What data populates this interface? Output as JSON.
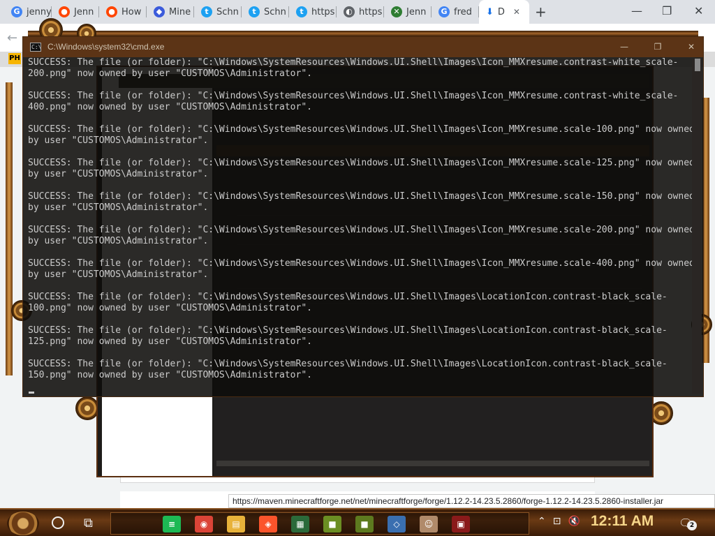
{
  "browser": {
    "tabs": [
      {
        "title": "jenny",
        "icon": "google-icon",
        "color": "#4285f4",
        "glyph": "G"
      },
      {
        "title": "Jenn",
        "icon": "reddit-icon",
        "color": "#ff4500",
        "glyph": "●"
      },
      {
        "title": "How",
        "icon": "reddit-icon",
        "color": "#ff4500",
        "glyph": "●"
      },
      {
        "title": "Mine",
        "icon": "shield-icon",
        "color": "#3b5bdb",
        "glyph": "◆"
      },
      {
        "title": "Schn",
        "icon": "twitter-icon",
        "color": "#1da1f2",
        "glyph": "t"
      },
      {
        "title": "Schn",
        "icon": "twitter-icon",
        "color": "#1da1f2",
        "glyph": "t"
      },
      {
        "title": "https",
        "icon": "twitter-icon",
        "color": "#1da1f2",
        "glyph": "t"
      },
      {
        "title": "https",
        "icon": "globe-icon",
        "color": "#5f6368",
        "glyph": "◐"
      },
      {
        "title": "Jenn",
        "icon": "sword-icon",
        "color": "#2e7d32",
        "glyph": "✕"
      },
      {
        "title": "fred",
        "icon": "google-icon",
        "color": "#4285f4",
        "glyph": "G"
      }
    ],
    "active_tab": {
      "title": "D",
      "icon": "download-icon",
      "glyph": "⬇"
    },
    "close_glyph": "✕",
    "new_tab_glyph": "+",
    "window_controls": {
      "minimize": "—",
      "maximize": "❐",
      "close": "✕"
    },
    "back_glyph": "←",
    "extensions": [
      "✦",
      "▣",
      "●",
      "⋮"
    ],
    "bookmark_badge": "PH"
  },
  "cmd": {
    "title": "C:\\Windows\\system32\\cmd.exe",
    "icon_glyph": "C:\\",
    "controls": {
      "minimize": "—",
      "maximize": "❐",
      "close": "✕"
    },
    "lines": [
      "SUCCESS: The file (or folder): \"C:\\Windows\\SystemResources\\Windows.UI.Shell\\Images\\Icon_MMXresume.contrast-white_scale-200.png\" now owned by user \"CUSTOMOS\\Administrator\".",
      "SUCCESS: The file (or folder): \"C:\\Windows\\SystemResources\\Windows.UI.Shell\\Images\\Icon_MMXresume.contrast-white_scale-400.png\" now owned by user \"CUSTOMOS\\Administrator\".",
      "SUCCESS: The file (or folder): \"C:\\Windows\\SystemResources\\Windows.UI.Shell\\Images\\Icon_MMXresume.scale-100.png\" now owned by user \"CUSTOMOS\\Administrator\".",
      "SUCCESS: The file (or folder): \"C:\\Windows\\SystemResources\\Windows.UI.Shell\\Images\\Icon_MMXresume.scale-125.png\" now owned by user \"CUSTOMOS\\Administrator\".",
      "SUCCESS: The file (or folder): \"C:\\Windows\\SystemResources\\Windows.UI.Shell\\Images\\Icon_MMXresume.scale-150.png\" now owned by user \"CUSTOMOS\\Administrator\".",
      "SUCCESS: The file (or folder): \"C:\\Windows\\SystemResources\\Windows.UI.Shell\\Images\\Icon_MMXresume.scale-200.png\" now owned by user \"CUSTOMOS\\Administrator\".",
      "SUCCESS: The file (or folder): \"C:\\Windows\\SystemResources\\Windows.UI.Shell\\Images\\Icon_MMXresume.scale-400.png\" now owned by user \"CUSTOMOS\\Administrator\".",
      "SUCCESS: The file (or folder): \"C:\\Windows\\SystemResources\\Windows.UI.Shell\\Images\\LocationIcon.contrast-black_scale-100.png\" now owned by user \"CUSTOMOS\\Administrator\".",
      "SUCCESS: The file (or folder): \"C:\\Windows\\SystemResources\\Windows.UI.Shell\\Images\\LocationIcon.contrast-black_scale-125.png\" now owned by user \"CUSTOMOS\\Administrator\".",
      "SUCCESS: The file (or folder): \"C:\\Windows\\SystemResources\\Windows.UI.Shell\\Images\\LocationIcon.contrast-black_scale-150.png\" now owned by user \"CUSTOMOS\\Administrator\"."
    ]
  },
  "status_url": "https://maven.minecraftforge.net/net/minecraftforge/forge/1.12.2-14.23.5.2860/forge-1.12.2-14.23.5.2860-installer.jar",
  "taskbar": {
    "cortana_icon": "cortana-icon",
    "taskview_glyph": "⧉",
    "apps": [
      {
        "name": "spotify",
        "color": "#1db954",
        "glyph": "≡"
      },
      {
        "name": "chrome",
        "color": "#db4437",
        "glyph": "◉"
      },
      {
        "name": "file-explorer",
        "color": "#e8b23a",
        "glyph": "▤"
      },
      {
        "name": "brave",
        "color": "#fb542b",
        "glyph": "◈"
      },
      {
        "name": "terminal",
        "color": "#2b6a3a",
        "glyph": "▦"
      },
      {
        "name": "minecraft",
        "color": "#6b8e23",
        "glyph": "■"
      },
      {
        "name": "minecraft-2",
        "color": "#5d7a1f",
        "glyph": "■"
      },
      {
        "name": "virtualbox",
        "color": "#3a6fb0",
        "glyph": "◇"
      },
      {
        "name": "photo",
        "color": "#b08a6a",
        "glyph": "☺"
      },
      {
        "name": "game",
        "color": "#8a1a1a",
        "glyph": "▣"
      }
    ],
    "tray_glyphs": [
      "⌃",
      "⊡",
      "🔇"
    ],
    "clock": "12:11 AM",
    "notification_glyph": "🗨",
    "notification_count": "2"
  }
}
